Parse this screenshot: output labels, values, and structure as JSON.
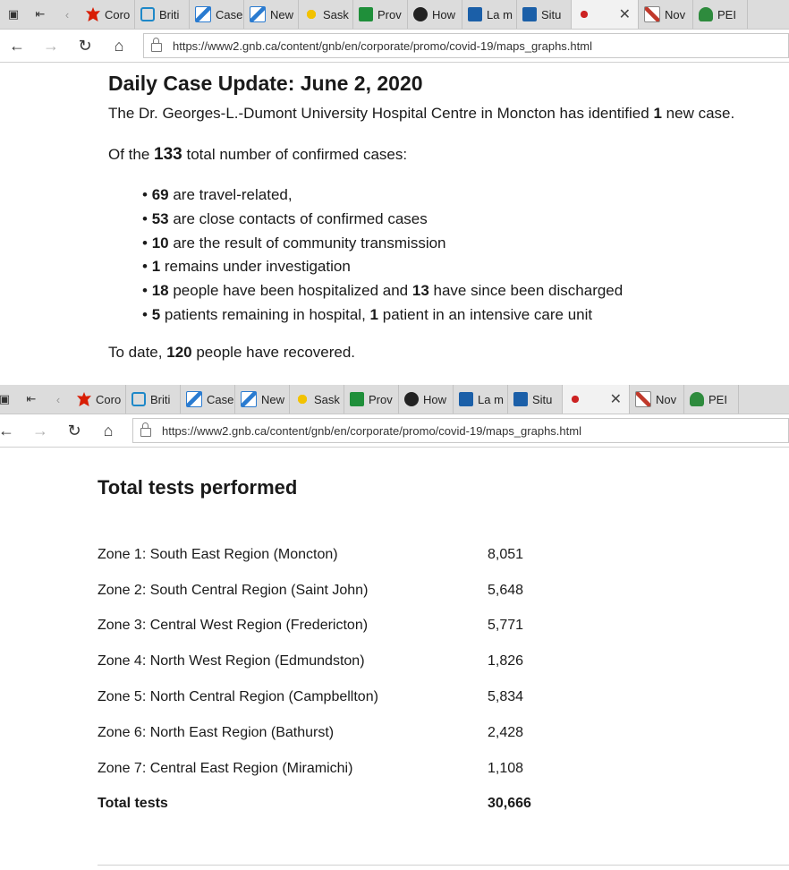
{
  "browser": {
    "tabs": [
      {
        "label": "Coro",
        "icon": "canada-flag-icon"
      },
      {
        "label": "Briti",
        "icon": "bc-icon"
      },
      {
        "label": "Case",
        "icon": "alberta-icon"
      },
      {
        "label": "New",
        "icon": "alberta-icon"
      },
      {
        "label": "Sask",
        "icon": "saskatchewan-icon"
      },
      {
        "label": "Prov",
        "icon": "manitoba-icon"
      },
      {
        "label": "How",
        "icon": "ontario-icon"
      },
      {
        "label": "La m",
        "icon": "quebec-icon"
      },
      {
        "label": "Situ",
        "icon": "quebec-icon"
      },
      {
        "label": "",
        "icon": "new-brunswick-icon"
      },
      {
        "label": "Nov",
        "icon": "nova-scotia-icon"
      },
      {
        "label": "PEI",
        "icon": "pei-icon"
      }
    ],
    "url": "https://www2.gnb.ca/content/gnb/en/corporate/promo/covid-19/maps_graphs.html"
  },
  "update": {
    "title": "Daily Case Update: June 2, 2020",
    "intro_prefix": "The Dr. Georges-L.-Dumont University Hospital Centre in Moncton has identified",
    "intro_new": "1",
    "intro_suffix": "new case.",
    "total_prefix": "Of the",
    "total_count": "133",
    "total_suffix": "total number of confirmed cases:",
    "items": [
      {
        "num": "69",
        "text": "are travel-related,"
      },
      {
        "num": "53",
        "text": "are close contacts of confirmed cases"
      },
      {
        "num": "10",
        "text": "are the result of community transmission"
      },
      {
        "num": "1",
        "text": "remains under investigation"
      },
      {
        "num": "18",
        "text": "people have been hospitalized and",
        "num2": "13",
        "text2": "have since been discharged"
      },
      {
        "num": "5",
        "text": "patients remaining in hospital,",
        "num2": "1",
        "text2": "patient in an intensive care unit"
      }
    ],
    "recovered_prefix": "To date,",
    "recovered_count": "120",
    "recovered_suffix": "people have recovered."
  },
  "tests": {
    "title": "Total tests performed",
    "rows": [
      {
        "zone": "Zone 1: South East Region (Moncton)",
        "count": "8,051"
      },
      {
        "zone": "Zone 2: South Central Region (Saint John)",
        "count": "5,648"
      },
      {
        "zone": "Zone 3: Central West Region (Fredericton)",
        "count": "5,771"
      },
      {
        "zone": "Zone 4: North West Region (Edmundston)",
        "count": "1,826"
      },
      {
        "zone": "Zone 5: North Central Region (Campbellton)",
        "count": "5,834"
      },
      {
        "zone": "Zone 6: North East Region (Bathurst)",
        "count": "2,428"
      },
      {
        "zone": "Zone 7: Central East Region (Miramichi)",
        "count": "1,108"
      }
    ],
    "total_label": "Total tests",
    "total_count": "30,666"
  }
}
